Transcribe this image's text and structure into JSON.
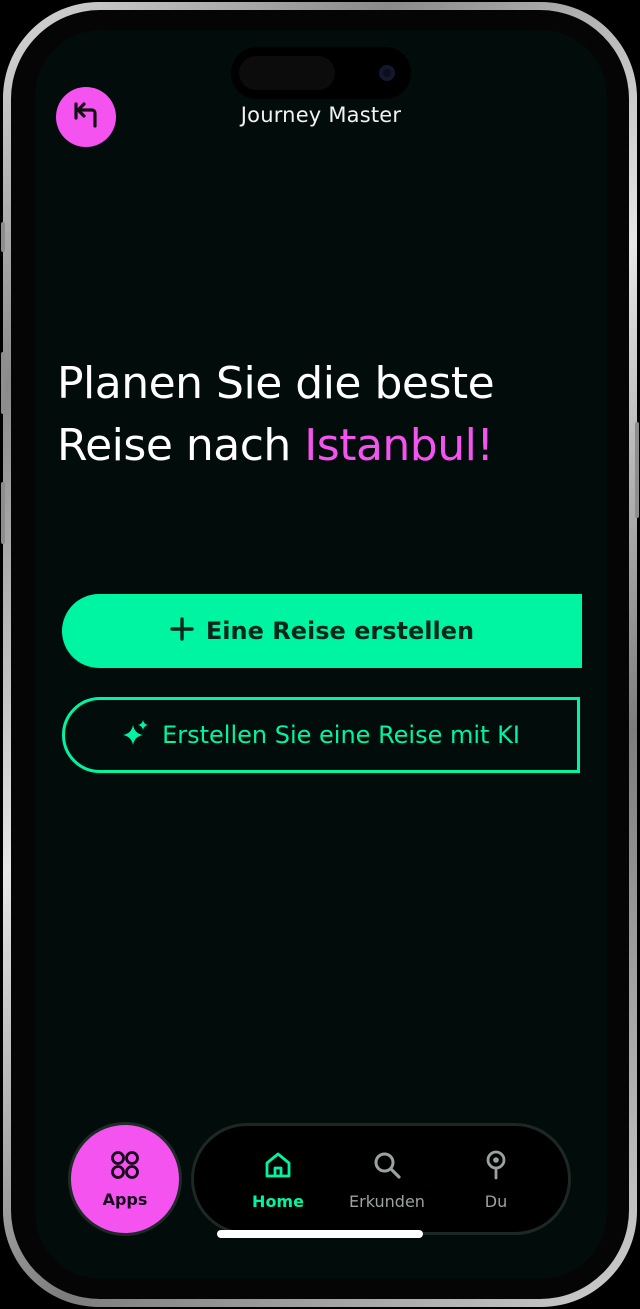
{
  "header": {
    "title": "Journey Master",
    "back_icon": "back-arrow-icon"
  },
  "hero": {
    "line1": "Planen Sie die beste",
    "line2_prefix": "Reise nach ",
    "line2_accent": "Istanbul!"
  },
  "actions": {
    "create_trip": {
      "label": "Eine Reise erstellen",
      "icon": "plus-icon"
    },
    "create_trip_ai": {
      "label": "Erstellen Sie eine Reise mit KI",
      "icon": "sparkle-icon"
    }
  },
  "bottom_nav": {
    "apps": {
      "label": "Apps",
      "icon": "apps-grid-icon"
    },
    "tabs": [
      {
        "label": "Home",
        "icon": "home-icon",
        "active": true
      },
      {
        "label": "Erkunden",
        "icon": "search-icon",
        "active": false
      },
      {
        "label": "Du",
        "icon": "location-pin-icon",
        "active": false
      }
    ]
  },
  "colors": {
    "background": "#020c0a",
    "accent_pink": "#f553f0",
    "accent_green": "#00f5a3",
    "text": "#ffffff"
  }
}
